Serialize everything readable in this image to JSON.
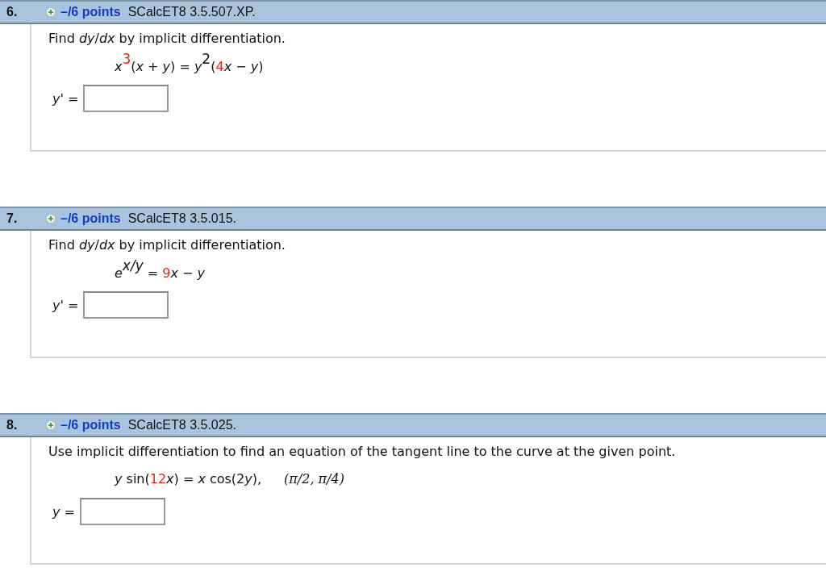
{
  "questions": [
    {
      "number": "6.",
      "points": "–/6 points",
      "code": "SCalcET8 3.5.507.XP.",
      "prompt": "Find *dy*/*dx* by implicit differentiation.",
      "equation": [
        {
          "text": "x",
          "kind": "var",
          "raised": false
        },
        {
          "text": "3",
          "kind": "param",
          "raised": true
        },
        {
          "text": "(",
          "kind": "plain",
          "raised": false
        },
        {
          "text": "x",
          "kind": "var",
          "raised": false
        },
        {
          "text": " + ",
          "kind": "plain",
          "raised": false
        },
        {
          "text": "y",
          "kind": "var",
          "raised": false
        },
        {
          "text": ") = ",
          "kind": "plain",
          "raised": false
        },
        {
          "text": "y",
          "kind": "var",
          "raised": false
        },
        {
          "text": "2",
          "kind": "plain",
          "raised": true
        },
        {
          "text": "(",
          "kind": "plain",
          "raised": false
        },
        {
          "text": "4",
          "kind": "param",
          "raised": false
        },
        {
          "text": "x",
          "kind": "var",
          "raised": false
        },
        {
          "text": " − ",
          "kind": "plain",
          "raised": false
        },
        {
          "text": "y",
          "kind": "var",
          "raised": false
        },
        {
          "text": ")",
          "kind": "plain",
          "raised": false
        }
      ],
      "answer_label": "*y'* ="
    },
    {
      "number": "7.",
      "points": "–/6 points",
      "code": "SCalcET8 3.5.015.",
      "prompt": "Find *dy*/*dx* by implicit differentiation.",
      "equation": [
        {
          "text": "e",
          "kind": "var",
          "raised": false
        },
        {
          "text": "x/y",
          "kind": "var",
          "raised": true
        },
        {
          "text": " = ",
          "kind": "plain",
          "raised": false
        },
        {
          "text": "9",
          "kind": "param",
          "raised": false
        },
        {
          "text": "x",
          "kind": "var",
          "raised": false
        },
        {
          "text": " − ",
          "kind": "plain",
          "raised": false
        },
        {
          "text": "y",
          "kind": "var",
          "raised": false
        }
      ],
      "answer_label": "*y'* ="
    },
    {
      "number": "8.",
      "points": "–/6 points",
      "code": "SCalcET8 3.5.025.",
      "prompt": "Use implicit differentiation to find an equation of the tangent line to the curve at the given point.",
      "equation": [
        {
          "text": "y",
          "kind": "var",
          "raised": false
        },
        {
          "text": " sin(",
          "kind": "plain",
          "raised": false
        },
        {
          "text": "12",
          "kind": "param",
          "raised": false
        },
        {
          "text": "x",
          "kind": "var",
          "raised": false
        },
        {
          "text": ") = ",
          "kind": "plain",
          "raised": false
        },
        {
          "text": "x",
          "kind": "var",
          "raised": false
        },
        {
          "text": " cos(2",
          "kind": "plain",
          "raised": false
        },
        {
          "text": "y",
          "kind": "var",
          "raised": false
        },
        {
          "text": "),",
          "kind": "plain",
          "raised": false
        }
      ],
      "point": "(π/2, π/4)",
      "answer_label": "*y* ="
    }
  ]
}
